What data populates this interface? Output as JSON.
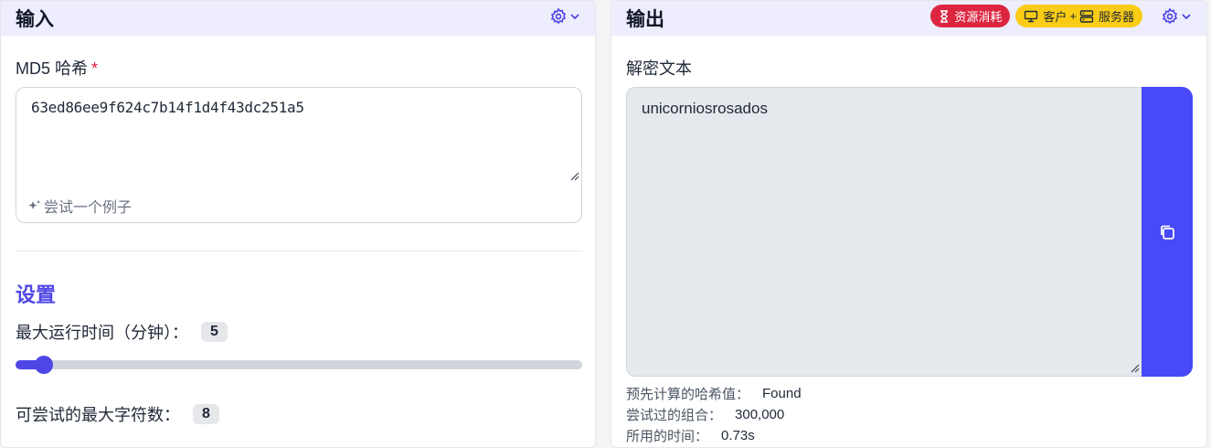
{
  "input_panel": {
    "title": "输入",
    "gear_icon": "gear-icon",
    "hash_field": {
      "label": "MD5 哈希",
      "required_mark": "*",
      "value": "63ed86ee9f624c7b14f1d4f43dc251a5"
    },
    "example_link": "尝试一个例子",
    "settings": {
      "title": "设置",
      "max_runtime": {
        "label": "最大运行时间（分钟）：",
        "value": "5",
        "fill_fraction": 0.05
      },
      "max_chars": {
        "label": "可尝试的最大字符数：",
        "value": "8"
      }
    }
  },
  "output_panel": {
    "title": "输出",
    "badges": {
      "resource": "资源消耗",
      "client": "客户",
      "plus": "+",
      "server": "服务器"
    },
    "output_field": {
      "label": "解密文本",
      "value": "unicorniosrosados"
    },
    "stats": [
      {
        "label": "预先计算的哈希值：",
        "value": "Found"
      },
      {
        "label": "尝试过的组合：",
        "value": "300,000"
      },
      {
        "label": "所用的时间：",
        "value": "0.73s"
      }
    ]
  },
  "colors": {
    "accent": "#4f46e5",
    "header_bg": "#ededfd",
    "badge_red": "#dc2640",
    "badge_yellow": "#facc15",
    "copy_button": "#4849f8"
  }
}
